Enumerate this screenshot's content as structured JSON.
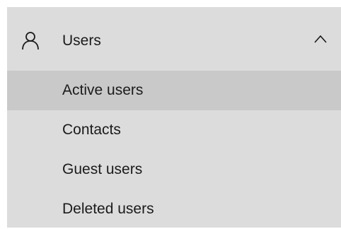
{
  "nav": {
    "group": {
      "label": "Users",
      "icon": "user-icon",
      "expanded": true,
      "chevron": "chevron-up-icon"
    },
    "items": [
      {
        "label": "Active users",
        "selected": true
      },
      {
        "label": "Contacts",
        "selected": false
      },
      {
        "label": "Guest users",
        "selected": false
      },
      {
        "label": "Deleted users",
        "selected": false
      }
    ]
  },
  "colors": {
    "panel_background": "#dcdcdc",
    "selected_background": "#c9c9c9",
    "text": "#1b1b1b"
  }
}
